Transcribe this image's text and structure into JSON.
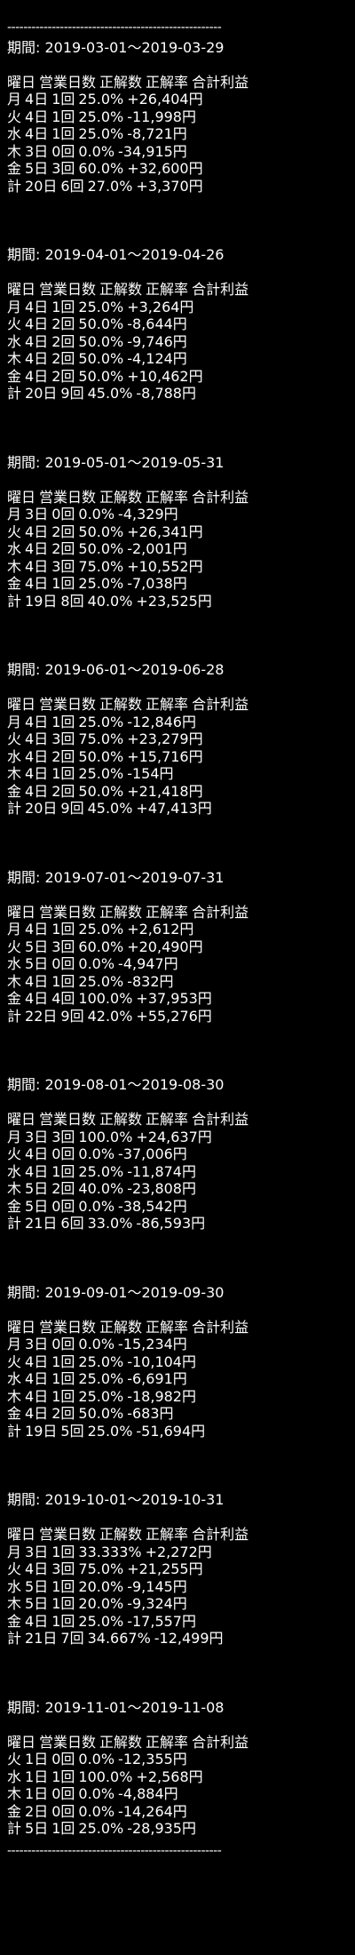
{
  "divider": "-----------------------------------------------------",
  "period_label": "期間:",
  "headers": [
    "曜日",
    "営業日数",
    "正解数",
    "正解率",
    "合計利益"
  ],
  "periods": [
    {
      "range": "2019-03-01～2019-03-29",
      "rows": [
        [
          "月",
          "4日",
          "1回",
          "25.0%",
          "+26,404円"
        ],
        [
          "火",
          "4日",
          "1回",
          "25.0%",
          "-11,998円"
        ],
        [
          "水",
          "4日",
          "1回",
          "25.0%",
          "-8,721円"
        ],
        [
          "木",
          "3日",
          "0回",
          "0.0%",
          "-34,915円"
        ],
        [
          "金",
          "5日",
          "3回",
          "60.0%",
          "+32,600円"
        ],
        [
          "計",
          "20日",
          "6回",
          "27.0%",
          "+3,370円"
        ]
      ]
    },
    {
      "range": "2019-04-01～2019-04-26",
      "rows": [
        [
          "月",
          "4日",
          "1回",
          "25.0%",
          "+3,264円"
        ],
        [
          "火",
          "4日",
          "2回",
          "50.0%",
          "-8,644円"
        ],
        [
          "水",
          "4日",
          "2回",
          "50.0%",
          "-9,746円"
        ],
        [
          "木",
          "4日",
          "2回",
          "50.0%",
          "-4,124円"
        ],
        [
          "金",
          "4日",
          "2回",
          "50.0%",
          "+10,462円"
        ],
        [
          "計",
          "20日",
          "9回",
          "45.0%",
          "-8,788円"
        ]
      ]
    },
    {
      "range": "2019-05-01～2019-05-31",
      "rows": [
        [
          "月",
          "3日",
          "0回",
          "0.0%",
          "-4,329円"
        ],
        [
          "火",
          "4日",
          "2回",
          "50.0%",
          "+26,341円"
        ],
        [
          "水",
          "4日",
          "2回",
          "50.0%",
          "-2,001円"
        ],
        [
          "木",
          "4日",
          "3回",
          "75.0%",
          "+10,552円"
        ],
        [
          "金",
          "4日",
          "1回",
          "25.0%",
          "-7,038円"
        ],
        [
          "計",
          "19日",
          "8回",
          "40.0%",
          "+23,525円"
        ]
      ]
    },
    {
      "range": "2019-06-01～2019-06-28",
      "rows": [
        [
          "月",
          "4日",
          "1回",
          "25.0%",
          "-12,846円"
        ],
        [
          "火",
          "4日",
          "3回",
          "75.0%",
          "+23,279円"
        ],
        [
          "水",
          "4日",
          "2回",
          "50.0%",
          "+15,716円"
        ],
        [
          "木",
          "4日",
          "1回",
          "25.0%",
          "-154円"
        ],
        [
          "金",
          "4日",
          "2回",
          "50.0%",
          "+21,418円"
        ],
        [
          "計",
          "20日",
          "9回",
          "45.0%",
          "+47,413円"
        ]
      ]
    },
    {
      "range": "2019-07-01～2019-07-31",
      "rows": [
        [
          "月",
          "4日",
          "1回",
          "25.0%",
          "+2,612円"
        ],
        [
          "火",
          "5日",
          "3回",
          "60.0%",
          "+20,490円"
        ],
        [
          "水",
          "5日",
          "0回",
          "0.0%",
          "-4,947円"
        ],
        [
          "木",
          "4日",
          "1回",
          "25.0%",
          "-832円"
        ],
        [
          "金",
          "4日",
          "4回",
          "100.0%",
          "+37,953円"
        ],
        [
          "計",
          "22日",
          "9回",
          "42.0%",
          "+55,276円"
        ]
      ]
    },
    {
      "range": "2019-08-01～2019-08-30",
      "rows": [
        [
          "月",
          "3日",
          "3回",
          "100.0%",
          "+24,637円"
        ],
        [
          "火",
          "4日",
          "0回",
          "0.0%",
          "-37,006円"
        ],
        [
          "水",
          "4日",
          "1回",
          "25.0%",
          "-11,874円"
        ],
        [
          "木",
          "5日",
          "2回",
          "40.0%",
          "-23,808円"
        ],
        [
          "金",
          "5日",
          "0回",
          "0.0%",
          "-38,542円"
        ],
        [
          "計",
          "21日",
          "6回",
          "33.0%",
          "-86,593円"
        ]
      ]
    },
    {
      "range": "2019-09-01～2019-09-30",
      "rows": [
        [
          "月",
          "3日",
          "0回",
          "0.0%",
          "-15,234円"
        ],
        [
          "火",
          "4日",
          "1回",
          "25.0%",
          "-10,104円"
        ],
        [
          "水",
          "4日",
          "1回",
          "25.0%",
          "-6,691円"
        ],
        [
          "木",
          "4日",
          "1回",
          "25.0%",
          "-18,982円"
        ],
        [
          "金",
          "4日",
          "2回",
          "50.0%",
          "-683円"
        ],
        [
          "計",
          "19日",
          "5回",
          "25.0%",
          "-51,694円"
        ]
      ]
    },
    {
      "range": "2019-10-01～2019-10-31",
      "rows": [
        [
          "月",
          "3日",
          "1回",
          "33.333%",
          "+2,272円"
        ],
        [
          "火",
          "4日",
          "3回",
          "75.0%",
          "+21,255円"
        ],
        [
          "水",
          "5日",
          "1回",
          "20.0%",
          "-9,145円"
        ],
        [
          "木",
          "5日",
          "1回",
          "20.0%",
          "-9,324円"
        ],
        [
          "金",
          "4日",
          "1回",
          "25.0%",
          "-17,557円"
        ],
        [
          "計",
          "21日",
          "7回",
          "34.667%",
          "-12,499円"
        ]
      ]
    },
    {
      "range": "2019-11-01～2019-11-08",
      "rows": [
        [
          "火",
          "1日",
          "0回",
          "0.0%",
          "-12,355円"
        ],
        [
          "水",
          "1日",
          "1回",
          "100.0%",
          "+2,568円"
        ],
        [
          "木",
          "1日",
          "0回",
          "0.0%",
          "-4,884円"
        ],
        [
          "金",
          "2日",
          "0回",
          "0.0%",
          "-14,264円"
        ],
        [
          "計",
          "5日",
          "1回",
          "25.0%",
          "-28,935円"
        ]
      ]
    }
  ]
}
